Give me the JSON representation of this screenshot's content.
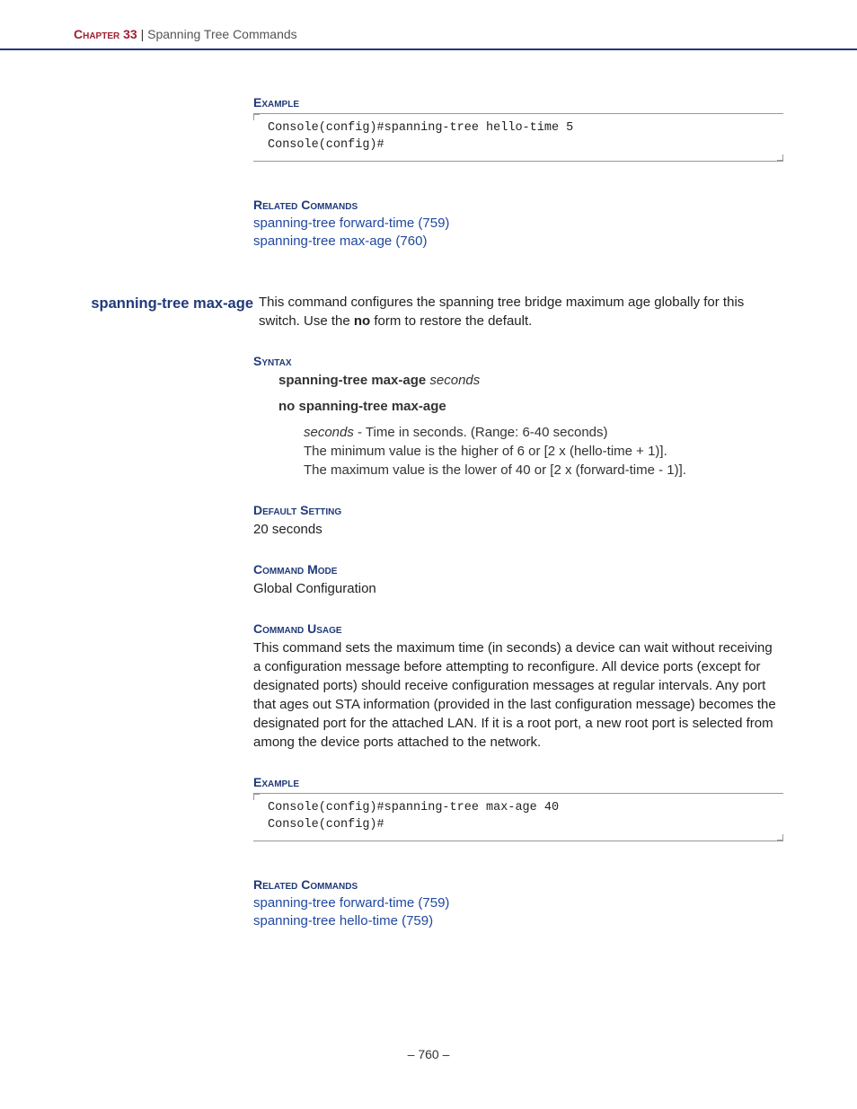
{
  "header": {
    "chapter_label": "Chapter 33",
    "separator": "  |  ",
    "chapter_title": "Spanning Tree Commands"
  },
  "section1": {
    "heading_example": "Example",
    "code": "Console(config)#spanning-tree hello-time 5\nConsole(config)#",
    "heading_related": "Related Commands",
    "related_links": [
      "spanning-tree forward-time (759)",
      "spanning-tree max-age (760)"
    ]
  },
  "command": {
    "name": "spanning-tree max-age",
    "desc_part1": "This command configures the spanning tree bridge maximum age globally for this switch. Use the ",
    "desc_bold": "no",
    "desc_part2": " form to restore the default."
  },
  "syntax": {
    "heading": "Syntax",
    "line1_bold": "spanning-tree max-age",
    "line1_italic": " seconds",
    "line2_bold": "no spanning-tree max-age",
    "param_italic": "seconds",
    "param_text": " - Time in seconds. (Range: 6-40 seconds)",
    "param_line2": "The minimum value is the higher of 6 or [2 x (hello-time + 1)].",
    "param_line3": "The maximum value is the lower of 40 or [2 x (forward-time - 1)]."
  },
  "default_setting": {
    "heading": "Default Setting",
    "text": "20 seconds"
  },
  "command_mode": {
    "heading": "Command Mode",
    "text": "Global Configuration"
  },
  "command_usage": {
    "heading": "Command Usage",
    "text": "This command sets the maximum time (in seconds) a device can wait without receiving a configuration message before attempting to reconfigure. All device ports (except for designated ports) should receive configuration messages at regular intervals. Any port that ages out STA information (provided in the last configuration message) becomes the designated port for the attached LAN. If it is a root port, a new root port is selected from among the device ports attached to the network."
  },
  "section2": {
    "heading_example": "Example",
    "code": "Console(config)#spanning-tree max-age 40\nConsole(config)#",
    "heading_related": "Related Commands",
    "related_links": [
      "spanning-tree forward-time (759)",
      "spanning-tree hello-time (759)"
    ]
  },
  "footer": {
    "page": "– 760 –"
  }
}
